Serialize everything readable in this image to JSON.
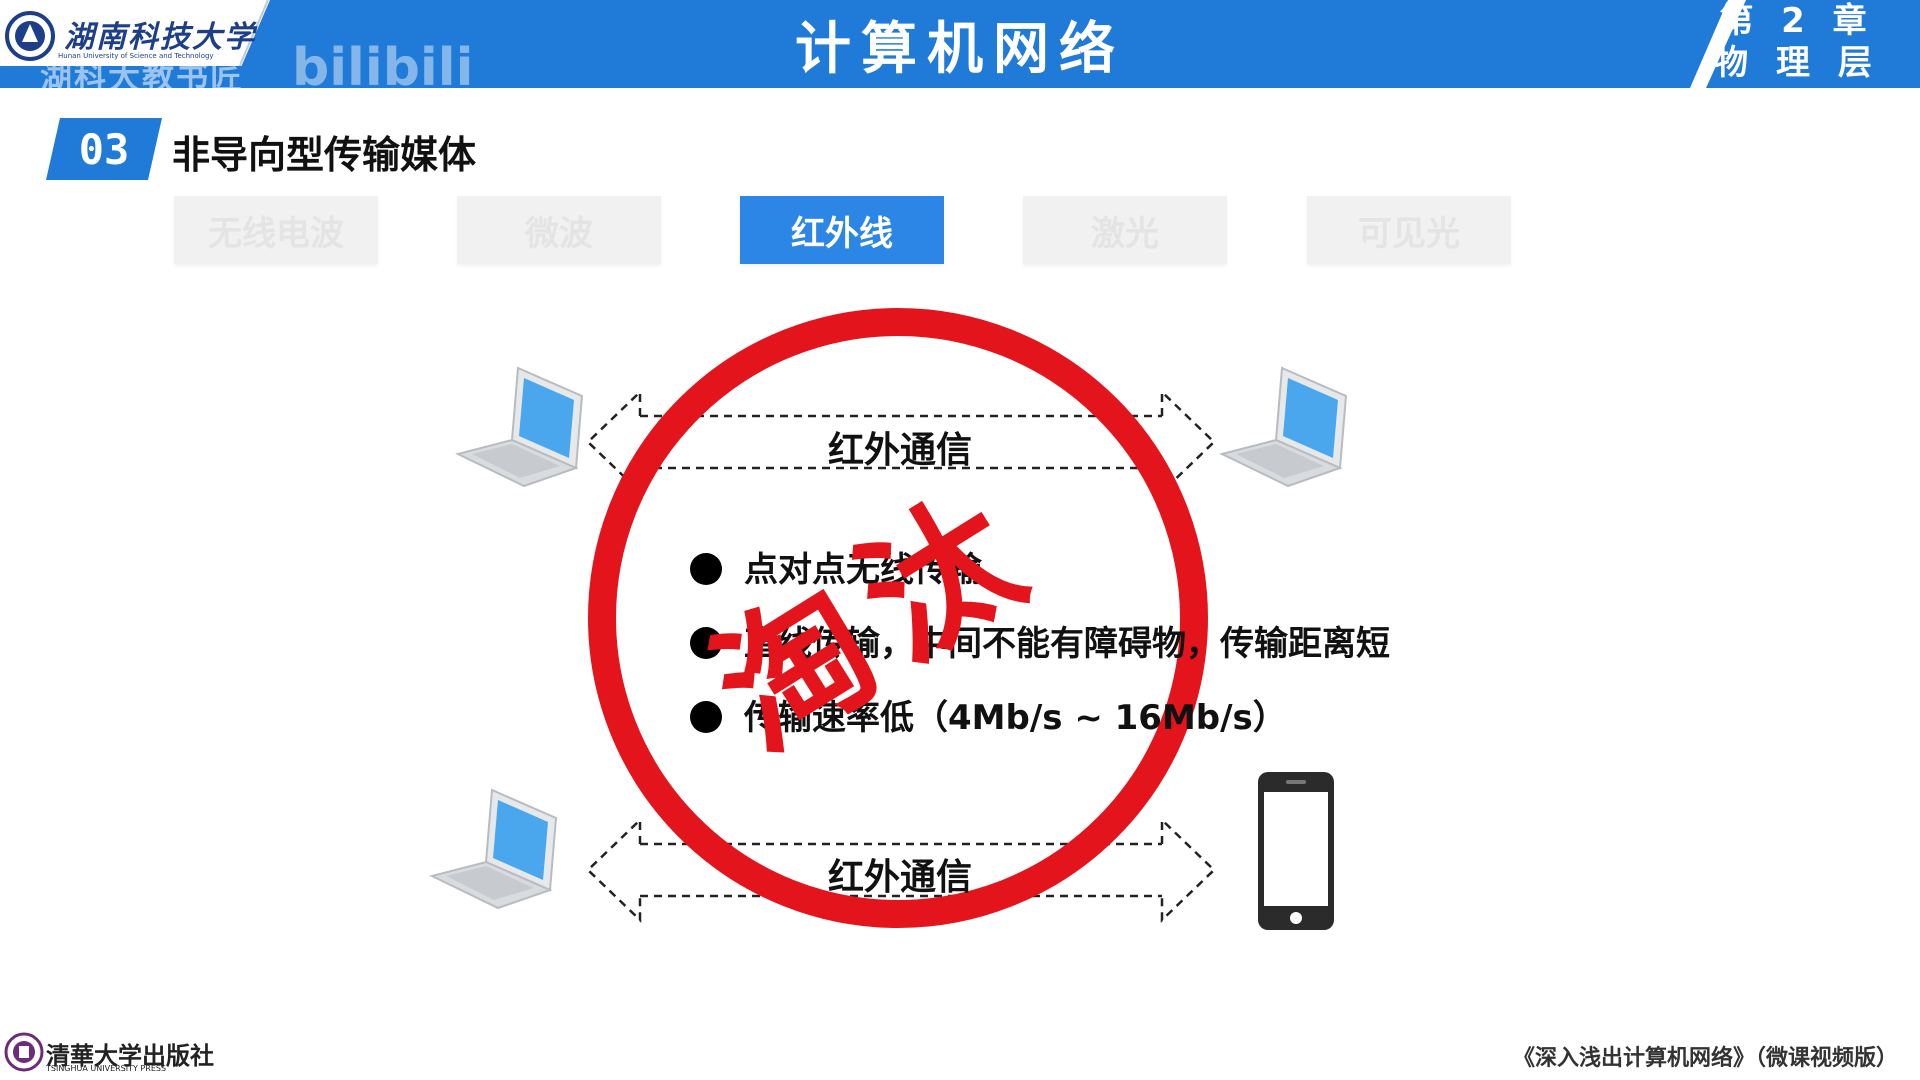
{
  "header": {
    "title": "计算机网络",
    "chapter_line1": "第 2 章",
    "chapter_line2": "物 理 层",
    "university_cn": "湖南科技大学",
    "university_en": "Hunan University of Science and Technology",
    "watermark": "湖科大教书匠",
    "bilibili": "bilibili"
  },
  "section": {
    "number": "03",
    "title": "非导向型传输媒体"
  },
  "tabs": [
    {
      "label": "无线电波",
      "active": false
    },
    {
      "label": "微波",
      "active": false
    },
    {
      "label": "红外线",
      "active": true
    },
    {
      "label": "激光",
      "active": false
    },
    {
      "label": "可见光",
      "active": false
    }
  ],
  "diagram": {
    "top_link_label": "红外通信",
    "bottom_link_label": "红外通信",
    "bullets": [
      "点对点无线传输",
      "直线传输，中间不能有障碍物，传输距离短",
      "传输速率低（4Mb/s ~ 16Mb/s）"
    ],
    "stamp_text": "淘汰",
    "colors": {
      "stamp": "#e3141b",
      "accent": "#2c86e6",
      "header": "#1f7ad8"
    }
  },
  "footer": {
    "press_cn": "清華大学出版社",
    "press_en": "TSINGHUA UNIVERSITY PRESS",
    "book_title": "《深入浅出计算机网络》（微课视频版）"
  }
}
